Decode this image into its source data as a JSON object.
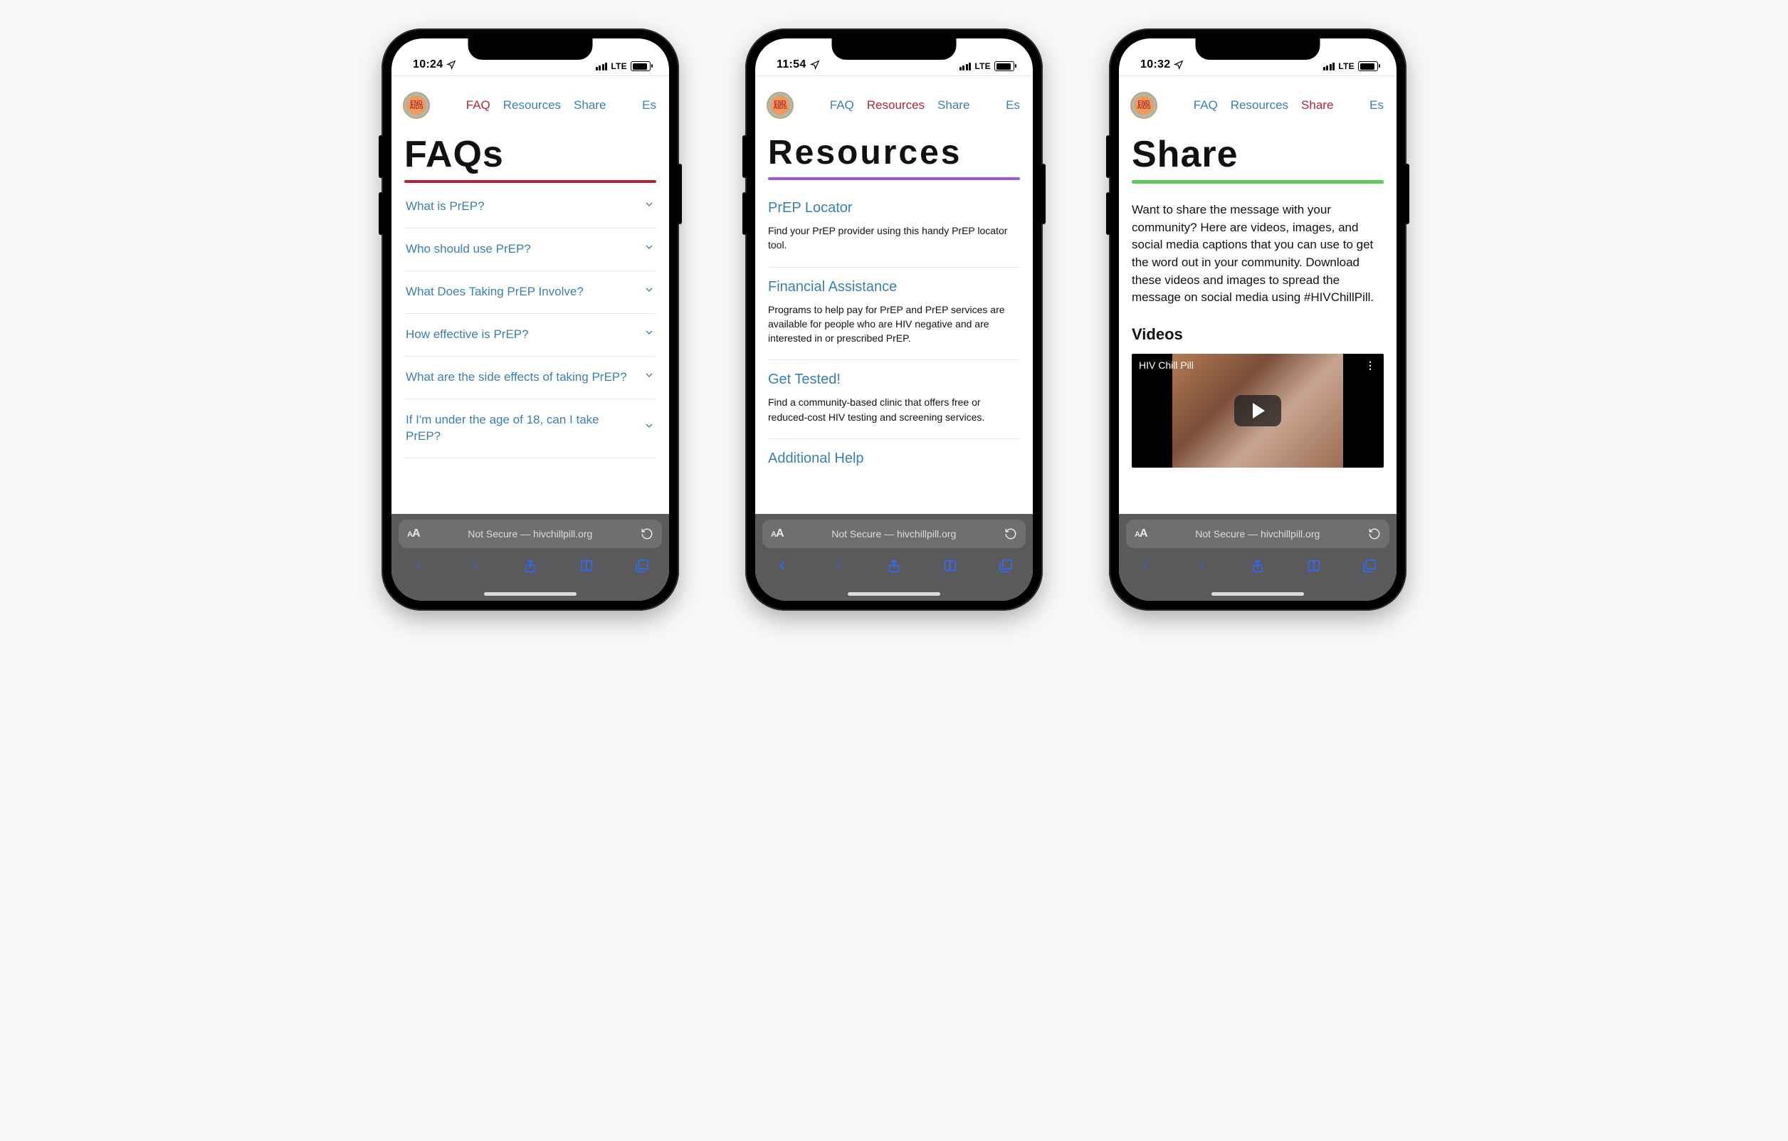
{
  "logo_text": "END\nAIDS",
  "nav": {
    "faq": "FAQ",
    "resources": "Resources",
    "share": "Share",
    "lang": "Es"
  },
  "status_network": "LTE",
  "safari": {
    "url_label": "Not Secure — hivchillpill.org",
    "text_size_label": "AA"
  },
  "phones": [
    {
      "id": "faq",
      "time": "10:24",
      "active_nav_key": "faq",
      "title": "FAQs",
      "accent_class": "faq",
      "back_enabled": false,
      "forward_enabled": false,
      "faq_items": [
        "What is PrEP?",
        "Who should use PrEP?",
        "What Does Taking PrEP Involve?",
        "How effective is PrEP?",
        "What are the side effects of taking PrEP?",
        "If I'm under the age of 18, can I take PrEP?"
      ]
    },
    {
      "id": "resources",
      "time": "11:54",
      "active_nav_key": "resources",
      "title": "Resources",
      "accent_class": "resources",
      "back_enabled": true,
      "forward_enabled": false,
      "resource_items": [
        {
          "title": "PrEP Locator",
          "desc": "Find your PrEP provider using this handy PrEP locator tool."
        },
        {
          "title": "Financial Assistance",
          "desc": "Programs to help pay for PrEP and PrEP services are available for people who are HIV negative and are interested in or prescribed PrEP."
        },
        {
          "title": "Get Tested!",
          "desc": "Find a community-based clinic that offers free or reduced-cost HIV testing and screening services."
        },
        {
          "title": "Additional Help",
          "desc": "",
          "partial": true
        }
      ]
    },
    {
      "id": "share",
      "time": "10:32",
      "active_nav_key": "share",
      "title": "Share",
      "accent_class": "share",
      "back_enabled": false,
      "forward_enabled": false,
      "share_body": "Want to share the message with your community? Here are videos, images, and social media captions that you can use to get the word out in your community. Download these videos and images to spread the message on social media using #HIVChillPill.",
      "videos_heading": "Videos",
      "video_title": "HIV Chill Pill"
    }
  ]
}
